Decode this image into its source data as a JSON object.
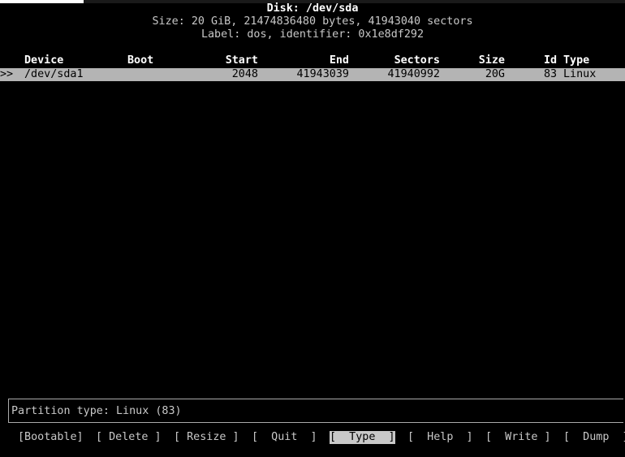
{
  "header": {
    "disk_title": "Disk: /dev/sda",
    "size_line": "Size: 20 GiB, 21474836480 bytes, 41943040 sectors",
    "label_line": "Label: dos, identifier: 0x1e8df292"
  },
  "table": {
    "columns": {
      "device": "Device",
      "boot": "Boot",
      "start": "Start",
      "end": "End",
      "sectors": "Sectors",
      "size": "Size",
      "id": "Id",
      "type": "Type"
    },
    "rows": [
      {
        "cursor": ">>",
        "device": "/dev/sda1",
        "boot": "",
        "start": "2048",
        "end": "41943039",
        "sectors": "41940992",
        "size": "20G",
        "id": "83",
        "type": "Linux"
      }
    ]
  },
  "info": {
    "text": "Partition type: Linux (83)"
  },
  "menu": {
    "items": [
      {
        "label": "[Bootable]"
      },
      {
        "label": "[ Delete ]"
      },
      {
        "label": "[ Resize ]"
      },
      {
        "label": "[  Quit  ]"
      },
      {
        "label": "[  Type  ]",
        "selected": true
      },
      {
        "label": "[  Help  ]"
      },
      {
        "label": "[  Write ]"
      },
      {
        "label": "[  Dump  ]"
      }
    ]
  },
  "colors": {
    "background": "#000000",
    "text": "#c8c8c8",
    "highlight": "#b4b4b4",
    "highlight_text": "#000000"
  }
}
